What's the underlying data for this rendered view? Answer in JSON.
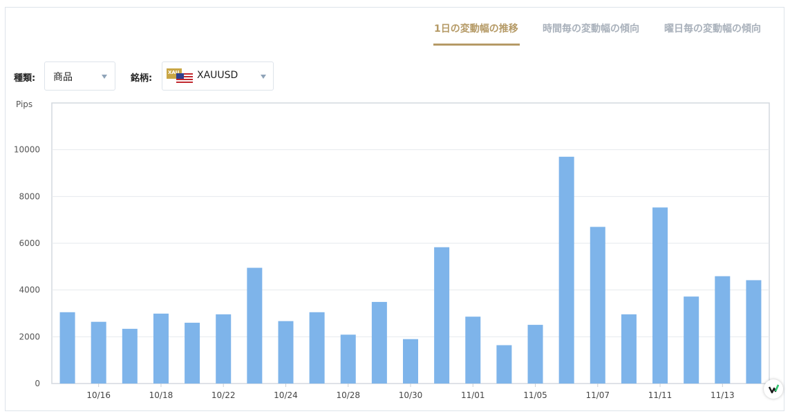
{
  "tabs": [
    {
      "label": "1日の変動幅の推移",
      "active": true
    },
    {
      "label": "時間毎の変動幅の傾向",
      "active": false
    },
    {
      "label": "曜日毎の変動幅の傾向",
      "active": false
    }
  ],
  "filters": {
    "type_label": "種類:",
    "type_value": "商品",
    "symbol_label": "銘柄:",
    "symbol_value": "XAUUSD",
    "symbol_badge": "XAU",
    "symbol_icon": "gold-us-flag-icon"
  },
  "colors": {
    "accent": "#b59a66",
    "bar": "#7eb4ea",
    "tab_inactive": "#a9b1bb"
  },
  "chart_data": {
    "type": "bar",
    "ylabel": "Pips",
    "ylim": [
      0,
      12000
    ],
    "yticks": [
      0,
      2000,
      4000,
      6000,
      8000,
      10000
    ],
    "xtick_labels": [
      "10/16",
      "10/18",
      "10/22",
      "10/24",
      "10/28",
      "10/30",
      "11/01",
      "11/05",
      "11/07",
      "11/11",
      "11/13"
    ],
    "xtick_indices": [
      1,
      3,
      5,
      7,
      9,
      11,
      13,
      15,
      17,
      19,
      21
    ],
    "values": [
      3050,
      2640,
      2340,
      2990,
      2600,
      2960,
      4950,
      2670,
      3050,
      2090,
      3490,
      1900,
      5830,
      2860,
      1640,
      2510,
      9700,
      6700,
      2960,
      7530,
      3720,
      4590,
      4420
    ],
    "grid": true,
    "legend": "none"
  }
}
